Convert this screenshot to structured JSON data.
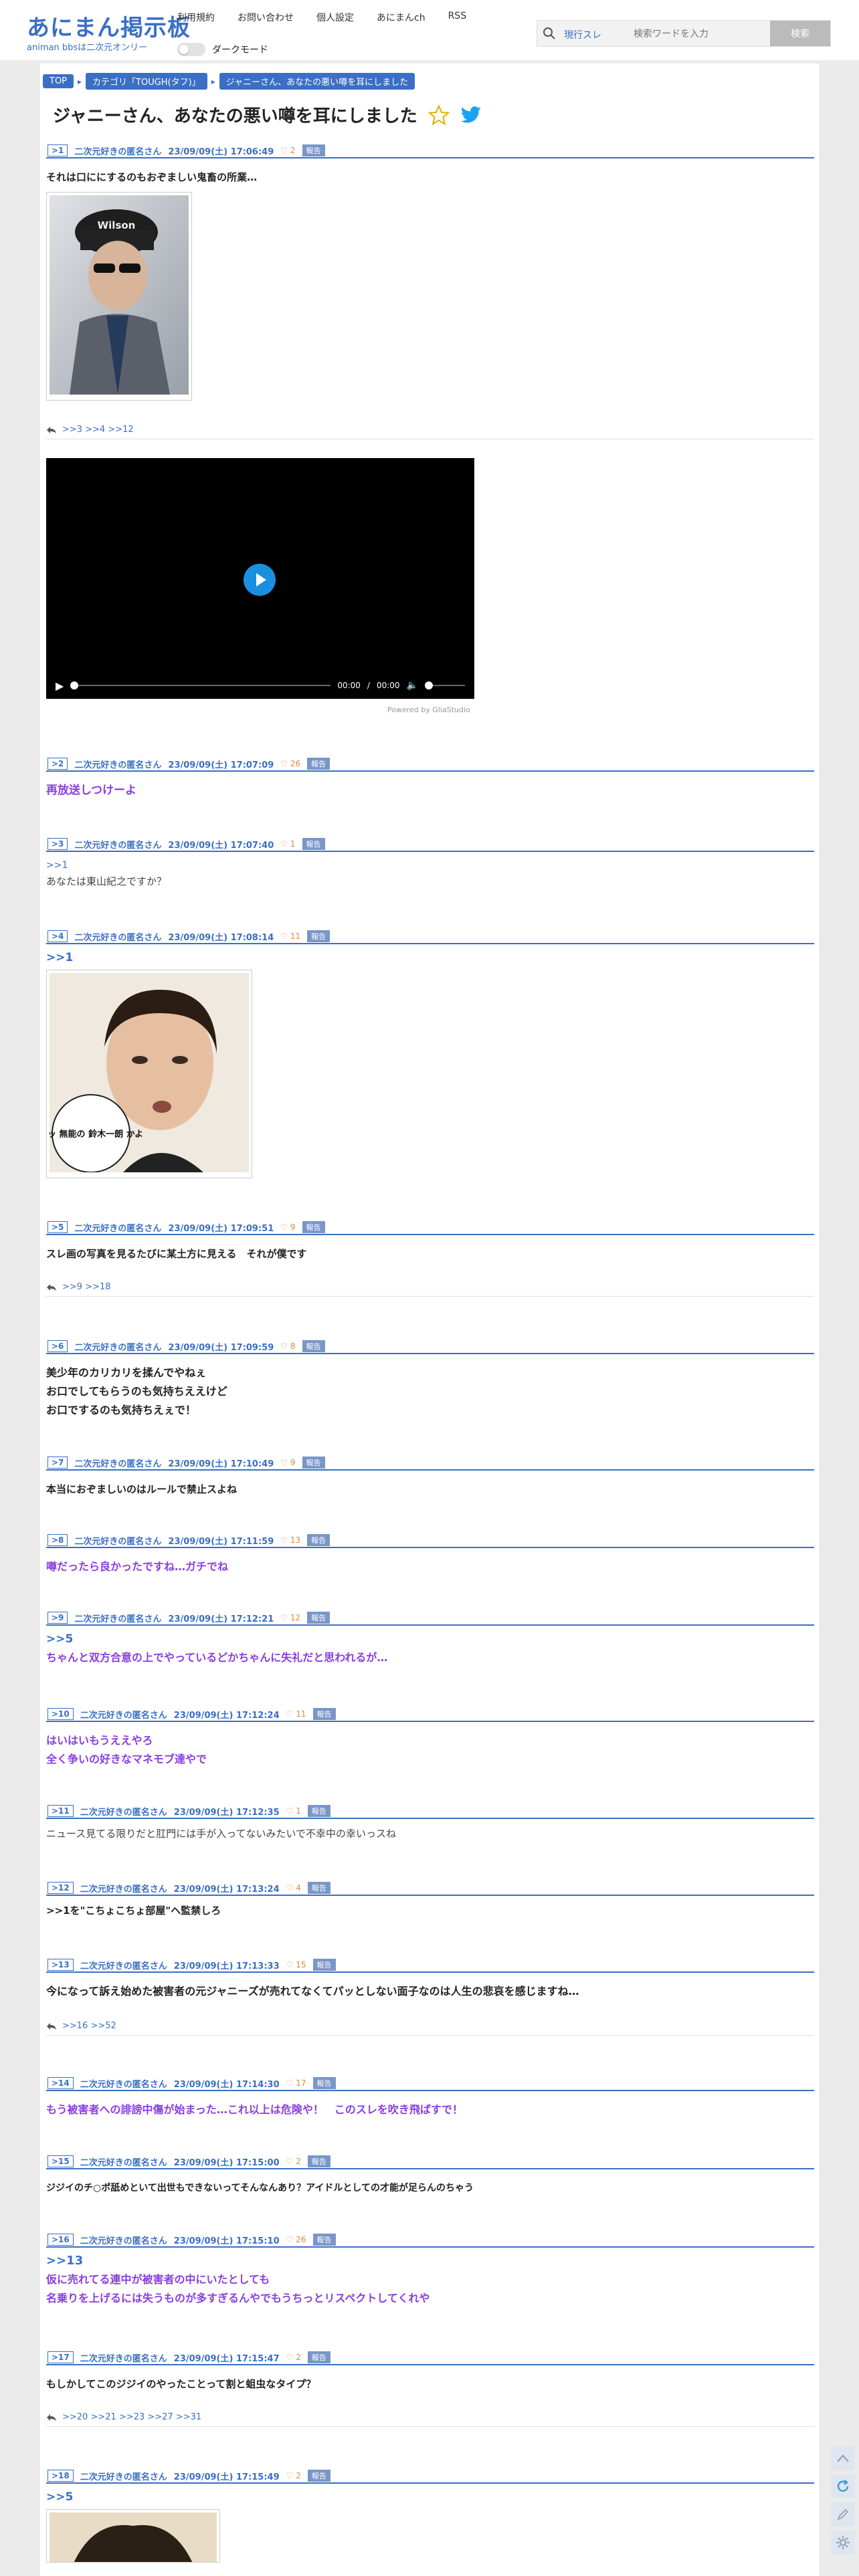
{
  "header": {
    "logo_title": "あにまん掲示板",
    "logo_sub": "animan bbsは二次元オンリー",
    "nav": [
      "利用規約",
      "お問い合わせ",
      "個人設定",
      "あにまんch",
      "RSS"
    ],
    "dark_mode_label": "ダークモード",
    "search_scope": "現行スレ",
    "search_placeholder": "検索ワードを入力",
    "search_button": "検索"
  },
  "breadcrumb": [
    "TOP",
    "カテゴリ「TOUGH(タフ)」",
    "ジャニーさん、あなたの悪い噂を耳にしました"
  ],
  "thread_title": "ジャニーさん、あなたの悪い噂を耳にしました",
  "posts": [
    {
      "num": ">1",
      "name": "二次元好きの匿名さん",
      "date": "23/09/09(土) 17:06:49",
      "likes": "2",
      "report": "報告",
      "body": [
        "それは口ににするのもおぞましい鬼畜の所業…"
      ],
      "replies": ">>3 >>4 >>12"
    },
    {
      "num": ">2",
      "name": "二次元好きの匿名さん",
      "date": "23/09/09(土) 17:07:09",
      "likes": "26",
      "report": "報告",
      "body": [
        "再放送しつけーよ"
      ]
    },
    {
      "num": ">3",
      "name": "二次元好きの匿名さん",
      "date": "23/09/09(土) 17:07:40",
      "likes": "1",
      "report": "報告",
      "anchor": ">>1",
      "body": [
        "あなたは東山紀之ですか？"
      ]
    },
    {
      "num": ">4",
      "name": "二次元好きの匿名さん",
      "date": "23/09/09(土) 17:08:14",
      "likes": "11",
      "report": "報告",
      "anchor": ">>1",
      "image_text": "チッ 無能の 鈴木一朗 かよ"
    },
    {
      "num": ">5",
      "name": "二次元好きの匿名さん",
      "date": "23/09/09(土) 17:09:51",
      "likes": "9",
      "report": "報告",
      "body": [
        "スレ画の写真を見るたびに某土方に見える　それが僕です"
      ],
      "replies": ">>9 >>18"
    },
    {
      "num": ">6",
      "name": "二次元好きの匿名さん",
      "date": "23/09/09(土) 17:09:59",
      "likes": "8",
      "report": "報告",
      "body": [
        "美少年のカリカリを揉んでやねぇ",
        "お口でしてもらうのも気持ちええけど",
        "お口でするのも気持ちえぇで！"
      ]
    },
    {
      "num": ">7",
      "name": "二次元好きの匿名さん",
      "date": "23/09/09(土) 17:10:49",
      "likes": "9",
      "report": "報告",
      "body": [
        "本当におぞましいのはルールで禁止スよね"
      ]
    },
    {
      "num": ">8",
      "name": "二次元好きの匿名さん",
      "date": "23/09/09(土) 17:11:59",
      "likes": "13",
      "report": "報告",
      "body": [
        "噂だったら良かったですね…ガチでね"
      ]
    },
    {
      "num": ">9",
      "name": "二次元好きの匿名さん",
      "date": "23/09/09(土) 17:12:21",
      "likes": "12",
      "report": "報告",
      "anchor": ">>5",
      "body": [
        "ちゃんと双方合意の上でやっているどかちゃんに失礼だと思われるが…"
      ]
    },
    {
      "num": ">10",
      "name": "二次元好きの匿名さん",
      "date": "23/09/09(土) 17:12:24",
      "likes": "11",
      "report": "報告",
      "body": [
        "はいはいもうええやろ",
        "全く争いの好きなマネモブ達やで"
      ]
    },
    {
      "num": ">11",
      "name": "二次元好きの匿名さん",
      "date": "23/09/09(土) 17:12:35",
      "likes": "1",
      "report": "報告",
      "body": [
        "ニュース見てる限りだと肛門には手が入ってないみたいで不幸中の幸いっスね"
      ]
    },
    {
      "num": ">12",
      "name": "二次元好きの匿名さん",
      "date": "23/09/09(土) 17:13:24",
      "likes": "4",
      "report": "報告",
      "body": [
        ">>1を\"こちょこちょ部屋\"へ監禁しろ"
      ]
    },
    {
      "num": ">13",
      "name": "二次元好きの匿名さん",
      "date": "23/09/09(土) 17:13:33",
      "likes": "15",
      "report": "報告",
      "body": [
        "今になって訴え始めた被害者の元ジャニーズが売れてなくてパッとしない面子なのは人生の悲哀を感じますね…"
      ],
      "replies": ">>16 >>52"
    },
    {
      "num": ">14",
      "name": "二次元好きの匿名さん",
      "date": "23/09/09(土) 17:14:30",
      "likes": "17",
      "report": "報告",
      "body": [
        "もう被害者への誹謗中傷が始まった…これ以上は危険や！　このスレを吹き飛ばすで！"
      ]
    },
    {
      "num": ">15",
      "name": "二次元好きの匿名さん",
      "date": "23/09/09(土) 17:15:00",
      "likes": "2",
      "report": "報告",
      "body": [
        "ジジイのチ○ポ舐めといて出世もできないってそんなんあり？アイドルとしての才能が足らんのちゃう"
      ]
    },
    {
      "num": ">16",
      "name": "二次元好きの匿名さん",
      "date": "23/09/09(土) 17:15:10",
      "likes": "26",
      "report": "報告",
      "anchor": ">>13",
      "body": [
        "仮に売れてる連中が被害者の中にいたとしても",
        "名乗りを上げるには失うものが多すぎるんやでもうちっとリスペクトしてくれや"
      ]
    },
    {
      "num": ">17",
      "name": "二次元好きの匿名さん",
      "date": "23/09/09(土) 17:15:47",
      "likes": "2",
      "report": "報告",
      "body": [
        "もしかしてこのジジイのやったことって割と蛆虫なタイプ？"
      ],
      "replies": ">>20 >>21 >>23 >>27 >>31"
    },
    {
      "num": ">18",
      "name": "二次元好きの匿名さん",
      "date": "23/09/09(土) 17:15:49",
      "likes": "2",
      "report": "報告",
      "anchor": ">>5"
    }
  ],
  "video": {
    "time_current": "00:00",
    "time_sep": "/",
    "time_total": "00:00",
    "powered_by": "Powered by GliaStudio"
  },
  "colors": {
    "accent": "#3a6fc4",
    "purple": "#8a3de0",
    "like": "#e08a3c"
  }
}
